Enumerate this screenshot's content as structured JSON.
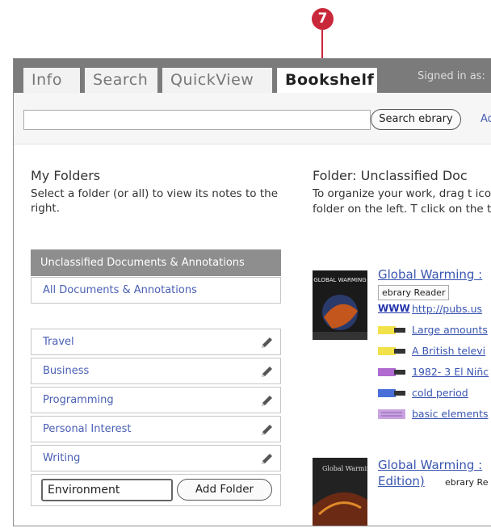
{
  "callout": {
    "number": "7"
  },
  "tabs": [
    {
      "label": "Info"
    },
    {
      "label": "Search"
    },
    {
      "label": "QuickView"
    },
    {
      "label": "Bookshelf"
    }
  ],
  "header": {
    "signed_in": "Signed in as:"
  },
  "search": {
    "query": "",
    "button": "Search ebrary",
    "advanced_link": "Ad"
  },
  "left_panel": {
    "heading": "My Folders",
    "description": "Select a folder (or all) to view its notes to the right.",
    "unclassified_label": "Unclassified Documents & Annotations",
    "all_docs_label": "All Documents & Annotations",
    "folders": [
      {
        "label": "Travel"
      },
      {
        "label": "Business"
      },
      {
        "label": "Programming"
      },
      {
        "label": "Personal Interest"
      },
      {
        "label": "Writing"
      }
    ],
    "new_folder_value": "Environment",
    "add_folder_button": "Add Folder"
  },
  "right_panel": {
    "heading": "Folder: Unclassified Doc",
    "description": "To organize your work, drag t icon to a folder on the left. T click on the title link.",
    "documents": [
      {
        "title": "Global Warming :",
        "badge": "ebrary Reader",
        "cover_text": "GLOBAL WARMING",
        "notes": [
          {
            "icon": "www-icon",
            "label": "http://pubs.us",
            "color": "#2233aa"
          },
          {
            "icon": "yellow-highlight-icon",
            "label": "Large amounts",
            "color": "#f2e24a"
          },
          {
            "icon": "yellow-highlight-icon",
            "label": "A British televi",
            "color": "#f2e24a"
          },
          {
            "icon": "purple-highlight-icon",
            "label": "1982- 3 El Niñc",
            "color": "#b06ad0"
          },
          {
            "icon": "blue-highlight-icon",
            "label": "cold period",
            "color": "#4a6fd8"
          },
          {
            "icon": "note-icon",
            "label": "basic elements",
            "color": "#c9a2e0"
          }
        ]
      },
      {
        "title": "Global Warming :",
        "title_line2": "Edition)",
        "badge": "ebrary Re",
        "cover_text": "Global Warming"
      }
    ]
  },
  "colors": {
    "accent": "#c8283a",
    "link": "#3a56b0",
    "tabbar": "#7b7b7b",
    "unclassified_bg": "#8e8e8e"
  }
}
